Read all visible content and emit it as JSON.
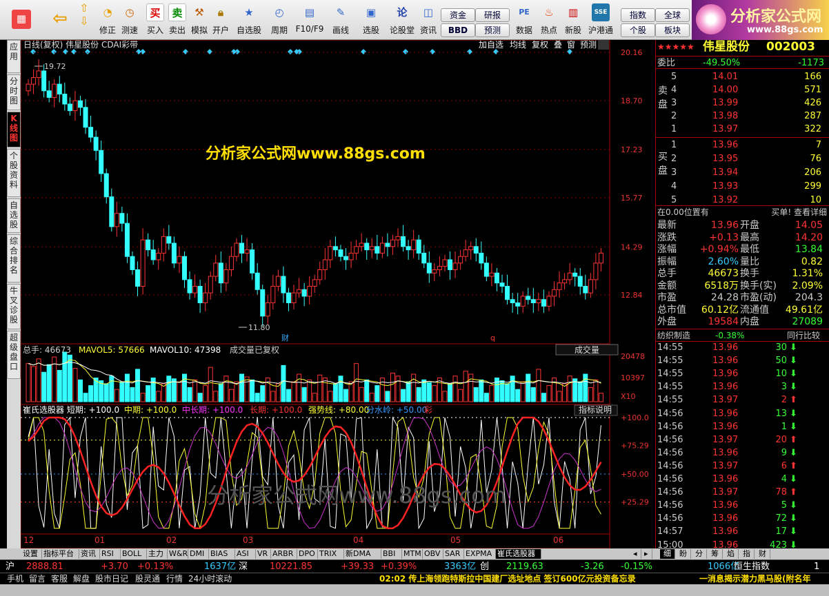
{
  "toolbar": {
    "buttons": [
      "修正",
      "测速",
      "买入",
      "卖出",
      "模拟",
      "开户",
      "自选股",
      "周期",
      "F10/F9",
      "画线",
      "选股",
      "论股堂",
      "资讯",
      "数据",
      "热点",
      "新股",
      "沪港通"
    ],
    "small_buttons": [
      "资金",
      "研报",
      "BBD",
      "预测",
      "指数",
      "全球",
      "个股",
      "板块"
    ]
  },
  "logo": {
    "title": "分析家公式网",
    "url": "www.88gs.com"
  },
  "sidetabs": [
    "应用",
    "分时图",
    "K线图",
    "个股资料",
    "自选股",
    "综合排名",
    "牛叉诊股",
    "超级盘口"
  ],
  "chart": {
    "header": "日线(复权)  伟星股份  CDAI彩带",
    "header_tabs": [
      "加自选",
      "均线",
      "复权",
      "叠",
      "窗",
      "预测"
    ],
    "price_axis": [
      "20.16",
      "18.70",
      "17.23",
      "15.77",
      "14.29",
      "12.84"
    ],
    "high_label": "19.72",
    "low_label": "11.80",
    "marker_cai": "财",
    "marker_q": "q",
    "watermark": "分析家公式网www.88gs.com",
    "vol_header": [
      "总手: 46673",
      "MAVOL5: 57666",
      "MAVOL10: 47398",
      "成交量已复权"
    ],
    "vol_select": "成交量",
    "vol_axis": [
      "20478",
      "10397",
      "X10"
    ],
    "ind_header": [
      "崔氏选股器 短期: +100.0",
      "中期: +100.0",
      "中长期: +100.0",
      "长期: +100.0",
      "强势线: +80.00",
      "分水岭: +50.00",
      "彩"
    ],
    "ind_button": "指标说明",
    "ind_axis": [
      "+100.0",
      "+75.29",
      "+50.00",
      "+25.29"
    ],
    "ind_watermark": "分析家公式网www.88gs.com",
    "months": [
      "12",
      "01",
      "02",
      "03",
      "04",
      "05",
      "06"
    ]
  },
  "chart_data": {
    "type": "candlestick",
    "title": "伟星股份 日线(复权)",
    "ylim": [
      11.8,
      20.16
    ],
    "high": 19.72,
    "low": 11.8,
    "close": [
      19.2,
      19.4,
      19.6,
      19.0,
      18.8,
      19.2,
      18.9,
      18.6,
      18.4,
      18.7,
      18.5,
      17.9,
      17.6,
      17.2,
      16.5,
      15.8,
      14.9,
      15.3,
      15.0,
      14.0,
      13.6,
      13.1,
      14.5,
      14.2,
      13.9,
      14.1,
      14.6,
      14.4,
      13.8,
      14.0,
      13.3,
      12.9,
      13.1,
      12.6,
      12.9,
      13.4,
      13.8,
      13.2,
      13.6,
      14.0,
      14.4,
      14.1,
      14.2,
      13.5,
      13.0,
      12.2,
      12.6,
      13.1,
      13.4,
      12.9,
      12.6,
      12.9,
      13.0,
      12.8,
      13.1,
      13.3,
      13.6,
      13.9,
      14.3,
      14.2,
      14.0,
      13.9,
      14.1,
      14.3,
      14.4,
      14.2,
      14.3,
      14.1,
      14.4,
      14.3,
      14.5,
      14.6,
      14.3,
      14.2,
      14.5,
      14.1,
      13.8,
      13.5,
      13.6,
      13.7,
      13.9,
      13.6,
      13.8,
      14.0,
      14.2,
      14.3,
      14.1,
      13.8,
      13.4,
      13.5,
      13.2,
      13.1,
      12.7,
      12.6,
      12.5,
      12.8,
      12.7,
      12.6,
      12.7,
      12.5,
      12.8,
      13.0,
      13.2,
      13.3,
      13.5,
      13.4,
      13.1,
      12.9,
      13.3,
      13.8,
      14.1
    ],
    "volume_ylim": [
      0,
      20478
    ],
    "indicator_ylim": [
      0,
      100
    ],
    "indicator_levels": [
      100,
      80,
      50,
      25.29
    ]
  },
  "quote": {
    "name": "伟星股份",
    "code": "002003",
    "wb_label": "委比",
    "wb_pct": "-49.50%",
    "wb_diff": "-1173",
    "sell_label": "卖盘",
    "buy_label": "买盘",
    "asks": [
      [
        "5",
        "14.01",
        "166"
      ],
      [
        "4",
        "14.00",
        "571"
      ],
      [
        "3",
        "13.99",
        "426"
      ],
      [
        "2",
        "13.98",
        "287"
      ],
      [
        "1",
        "13.97",
        "322"
      ]
    ],
    "bids": [
      [
        "1",
        "13.96",
        "7"
      ],
      [
        "2",
        "13.95",
        "76"
      ],
      [
        "3",
        "13.94",
        "206"
      ],
      [
        "4",
        "13.93",
        "299"
      ],
      [
        "5",
        "13.92",
        "10"
      ]
    ],
    "pos_text": "在0.00位置有",
    "pos_right": "买单! 查看详细",
    "stats": [
      [
        "最新",
        "13.96",
        "开盘",
        "14.05"
      ],
      [
        "涨跌",
        "+0.13",
        "最高",
        "14.20"
      ],
      [
        "涨幅",
        "+0.94%",
        "最低",
        "13.84"
      ],
      [
        "振幅",
        "2.60%",
        "量比",
        "0.82"
      ],
      [
        "总手",
        "46673",
        "换手",
        "1.31%"
      ],
      [
        "金额",
        "6518万",
        "换手(实)",
        "2.09%"
      ],
      [
        "市盈",
        "24.28",
        "市盈(动)",
        "204.3"
      ],
      [
        "总市值",
        "60.12亿",
        "流通值",
        "49.61亿"
      ],
      [
        "外盘",
        "19584",
        "内盘",
        "27089"
      ]
    ],
    "industry": "纺织制造",
    "industry_pct": "-0.38%",
    "compare": "同行比较",
    "ticks": [
      [
        "14:55",
        "13.96",
        "30",
        "down"
      ],
      [
        "14:55",
        "13.96",
        "50",
        "down"
      ],
      [
        "14:55",
        "13.96",
        "10",
        "down"
      ],
      [
        "14:55",
        "13.96",
        "3",
        "down"
      ],
      [
        "14:55",
        "13.97",
        "2",
        "up"
      ],
      [
        "14:56",
        "13.96",
        "13",
        "down"
      ],
      [
        "14:56",
        "13.96",
        "1",
        "down"
      ],
      [
        "14:56",
        "13.97",
        "20",
        "up"
      ],
      [
        "14:56",
        "13.96",
        "9",
        "down"
      ],
      [
        "14:56",
        "13.97",
        "6",
        "up"
      ],
      [
        "14:56",
        "13.96",
        "4",
        "down"
      ],
      [
        "14:56",
        "13.97",
        "78",
        "up"
      ],
      [
        "14:56",
        "13.96",
        "5",
        "down"
      ],
      [
        "14:56",
        "13.96",
        "72",
        "down"
      ],
      [
        "14:57",
        "13.96",
        "17",
        "down"
      ],
      [
        "15:00",
        "13.96",
        "423",
        "down"
      ]
    ]
  },
  "bottom_tabs": [
    "设置",
    "指标平台",
    "资讯",
    "RSI",
    "BOLL",
    "主力",
    "W&R",
    "DMI",
    "BIAS",
    "ASI",
    "VR",
    "ARBR",
    "DPO",
    "TRIX",
    "新DMA",
    "BBI",
    "MTM",
    "OBV",
    "SAR",
    "EXPMA",
    "崔氏选股器"
  ],
  "right_tabs": [
    "细",
    "盼",
    "分",
    "筹",
    "焰",
    "指",
    "财"
  ],
  "index_bar": {
    "sh_label": "沪",
    "sh_val": "2888.81",
    "sh_chg": "+3.70",
    "sh_pct": "+0.13%",
    "sh_amt": "1637亿",
    "sz_label": "深",
    "sz_val": "10221.85",
    "sz_chg": "+39.33",
    "sz_pct": "+0.39%",
    "sz_amt": "3363亿",
    "cy_label": "创",
    "cy_val": "2119.63",
    "cy_chg": "-3.26",
    "cy_pct": "-0.15%",
    "hk_amt": "1066亿",
    "hk_label": "恒生指数",
    "hk_val": "1"
  },
  "status": {
    "items": [
      "手机",
      "留言",
      "客服",
      "解盘",
      "股市日记",
      "股灵通",
      "行情",
      "24小时滚动"
    ],
    "news": "02:02 传上海领跑特斯拉中国建厂选址地点 签订600亿元投资备忘录",
    "news2": "一消息揭示潜力黑马股(附名年"
  }
}
